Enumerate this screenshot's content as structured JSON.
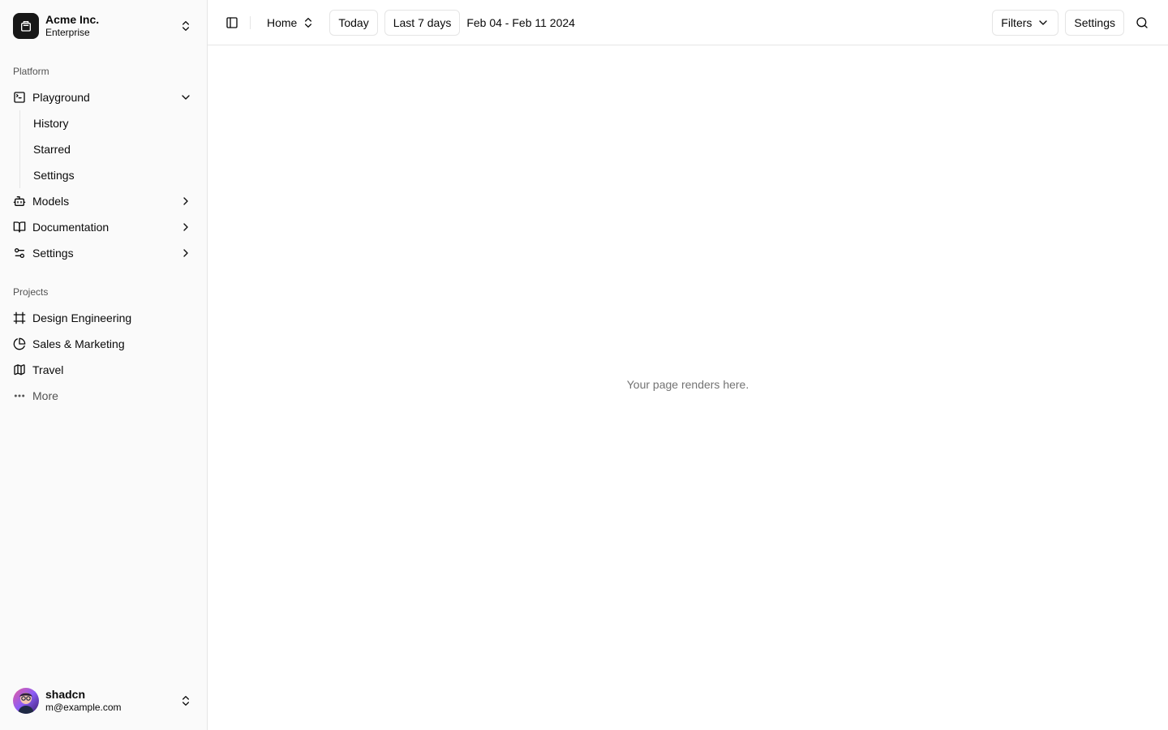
{
  "team": {
    "name": "Acme Inc.",
    "plan": "Enterprise"
  },
  "platform": {
    "label": "Platform",
    "items": [
      {
        "label": "Playground",
        "icon": "terminal-icon",
        "expanded": true,
        "children": [
          {
            "label": "History"
          },
          {
            "label": "Starred"
          },
          {
            "label": "Settings"
          }
        ]
      },
      {
        "label": "Models",
        "icon": "bot-icon"
      },
      {
        "label": "Documentation",
        "icon": "book-open-icon"
      },
      {
        "label": "Settings",
        "icon": "settings-2-icon"
      }
    ]
  },
  "projects": {
    "label": "Projects",
    "items": [
      {
        "label": "Design Engineering",
        "icon": "frame-icon"
      },
      {
        "label": "Sales & Marketing",
        "icon": "pie-chart-icon"
      },
      {
        "label": "Travel",
        "icon": "map-icon"
      }
    ],
    "more_label": "More"
  },
  "user": {
    "name": "shadcn",
    "email": "m@example.com"
  },
  "topbar": {
    "home_label": "Home",
    "today_label": "Today",
    "last7_label": "Last 7 days",
    "date_range": "Feb 04 - Feb 11 2024",
    "filters_label": "Filters",
    "settings_label": "Settings"
  },
  "content": {
    "placeholder": "Your page renders here."
  }
}
